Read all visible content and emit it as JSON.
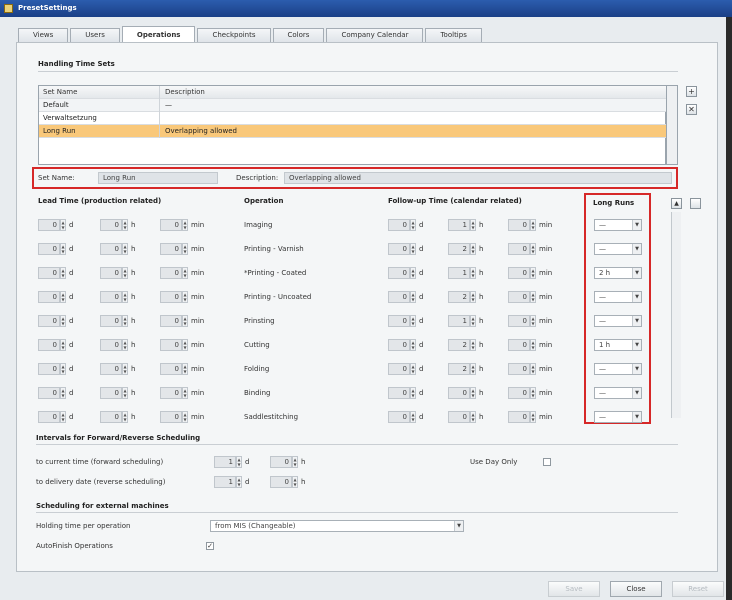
{
  "window": {
    "title": "PresetSettings"
  },
  "tabs": [
    "Views",
    "Users",
    "Operations",
    "Checkpoints",
    "Colors",
    "Company Calendar",
    "Tooltips"
  ],
  "active_tab": "Operations",
  "handling": {
    "section_title": "Handling Time Sets",
    "columns": [
      "Set Name",
      "Description"
    ],
    "rows": [
      {
        "name": "Default",
        "description": "—"
      },
      {
        "name": "Verwaltsetzung",
        "description": ""
      },
      {
        "name": "Long Run",
        "description": "Overlapping allowed",
        "selected": true
      }
    ],
    "add_label": "+",
    "delete_label": "✕"
  },
  "edit": {
    "set_name_label": "Set Name:",
    "set_name_value": "Long Run",
    "description_label": "Description:",
    "description_value": "Overlapping allowed"
  },
  "table": {
    "col_lead": "Lead Time (production related)",
    "col_operation": "Operation",
    "col_follow": "Follow-up Time (calendar related)",
    "col_long": "Long Runs",
    "unit_d": "d",
    "unit_h": "h",
    "unit_min": "min",
    "rows": [
      {
        "op": "Imaging",
        "lead": [
          "0",
          "0",
          "0"
        ],
        "follow": [
          "0",
          "1",
          "0"
        ],
        "long": "—"
      },
      {
        "op": "Printing - Varnish",
        "lead": [
          "0",
          "0",
          "0"
        ],
        "follow": [
          "0",
          "2",
          "0"
        ],
        "long": "—"
      },
      {
        "op": "*Printing - Coated",
        "lead": [
          "0",
          "0",
          "0"
        ],
        "follow": [
          "0",
          "1",
          "0"
        ],
        "long": "2 h"
      },
      {
        "op": "Printing - Uncoated",
        "lead": [
          "0",
          "0",
          "0"
        ],
        "follow": [
          "0",
          "2",
          "0"
        ],
        "long": "—"
      },
      {
        "op": "Prinsting",
        "lead": [
          "0",
          "0",
          "0"
        ],
        "follow": [
          "0",
          "1",
          "0"
        ],
        "long": "—"
      },
      {
        "op": "Cutting",
        "lead": [
          "0",
          "0",
          "0"
        ],
        "follow": [
          "0",
          "2",
          "0"
        ],
        "long": "1 h"
      },
      {
        "op": "Folding",
        "lead": [
          "0",
          "0",
          "0"
        ],
        "follow": [
          "0",
          "2",
          "0"
        ],
        "long": "—"
      },
      {
        "op": "Binding",
        "lead": [
          "0",
          "0",
          "0"
        ],
        "follow": [
          "0",
          "0",
          "0"
        ],
        "long": "—"
      },
      {
        "op": "Saddlestitching",
        "lead": [
          "0",
          "0",
          "0"
        ],
        "follow": [
          "0",
          "0",
          "0"
        ],
        "long": "—"
      }
    ]
  },
  "intervals": {
    "title": "Intervals for Forward/Reverse Scheduling",
    "row1_label": "to current time (forward scheduling)",
    "row1_d": "1",
    "row1_h": "0",
    "row2_label": "to delivery date (reverse scheduling)",
    "row2_d": "1",
    "row2_h": "0",
    "use_day_only": "Use Day Only"
  },
  "external": {
    "title": "Scheduling for external machines",
    "holding_label": "Holding time per operation",
    "holding_value": "from MIS (Changeable)",
    "autofinish_label": "AutoFinish Operations",
    "autofinish_checked": "✓"
  },
  "buttons": {
    "save": "Save",
    "close": "Close",
    "reset": "Reset"
  }
}
